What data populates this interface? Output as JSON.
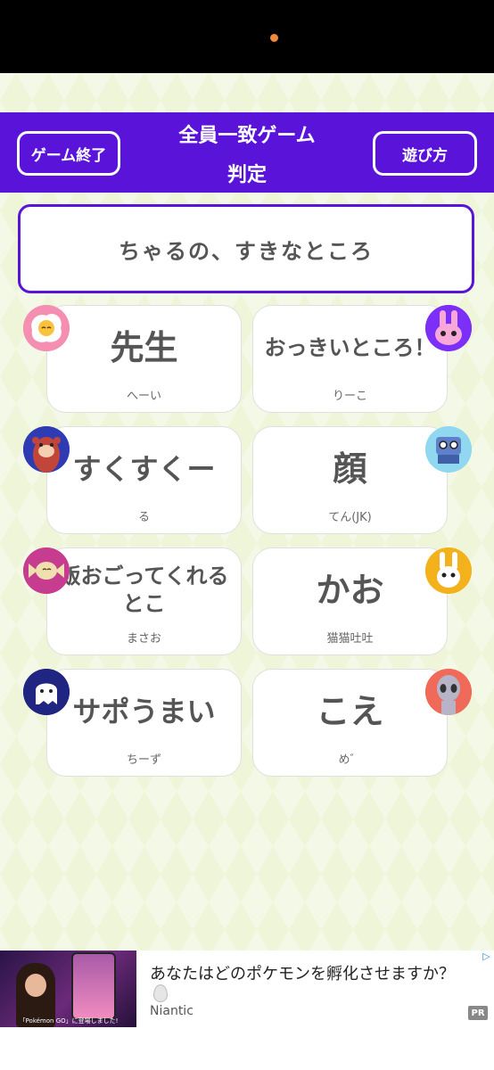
{
  "header": {
    "end_button": "ゲーム終了",
    "howto_button": "遊び方",
    "title_line1": "全員一致ゲーム",
    "title_line2": "判定"
  },
  "topic": "ちゃるの、すきなところ",
  "cards": [
    {
      "answer": "先生",
      "name": "へーい",
      "avatar": "fried-egg-icon"
    },
    {
      "answer": "おっきいところ！",
      "name": "りーこ",
      "avatar": "pink-rabbit-icon"
    },
    {
      "answer": "すくすくー",
      "name": "る",
      "avatar": "beaver-icon"
    },
    {
      "answer": "顔",
      "name": "てん(JK)",
      "avatar": "robot-book-icon"
    },
    {
      "answer": "飯おごってくれるとこ",
      "name": "まさお",
      "avatar": "candy-icon"
    },
    {
      "answer": "かお",
      "name": "猫猫吐吐",
      "avatar": "white-rabbit-icon"
    },
    {
      "answer": "サポうまい",
      "name": "ちーず",
      "avatar": "ghost-icon"
    },
    {
      "answer": "こえ",
      "name": "め゛",
      "avatar": "alien-icon"
    }
  ],
  "ad": {
    "title": "あなたはどのポケモンを孵化させますか？",
    "brand": "Niantic",
    "pr": "PR",
    "thumb_caption": "「Pokémon GO」に登場しました!"
  }
}
